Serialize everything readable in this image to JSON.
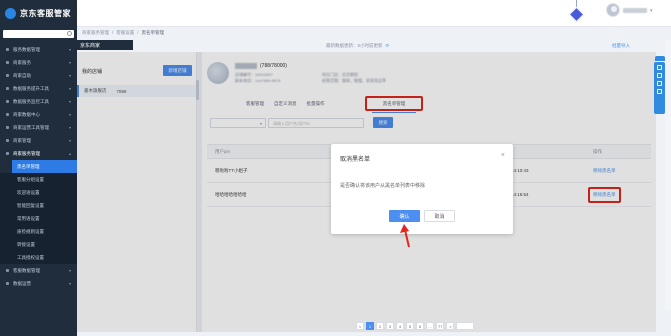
{
  "app": {
    "logo_text": "京东客服管家"
  },
  "breadcrumb": [
    "商家服务管理",
    "客服设置",
    "黑名单管理"
  ],
  "page_tab": "京东商家",
  "sync_text": "最新数据更新：5小时前更新",
  "right_link": "批量导入",
  "sidebar": {
    "search_placeholder": "",
    "items": [
      {
        "label": "服务数据管理",
        "open": false
      },
      {
        "label": "商家服务",
        "open": false
      },
      {
        "label": "商家自助",
        "open": false
      },
      {
        "label": "数据服务提升工具",
        "open": false
      },
      {
        "label": "数据服务监控工具",
        "open": false
      },
      {
        "label": "商家数据中心",
        "open": false
      },
      {
        "label": "商家运营工具管理",
        "open": false
      },
      {
        "label": "商家管理",
        "open": false
      },
      {
        "label": "商家服务管理",
        "open": true
      }
    ],
    "sub_items": [
      {
        "label": "黑名单管理",
        "active": true
      },
      {
        "label": "客服分组设置",
        "active": false
      },
      {
        "label": "欢迎语设置",
        "active": false
      },
      {
        "label": "智能回复设置",
        "active": false
      },
      {
        "label": "常用语设置",
        "active": false
      },
      {
        "label": "质检规则设置",
        "active": false
      },
      {
        "label": "转接设置",
        "active": false
      },
      {
        "label": "工具授权设置",
        "active": false
      }
    ],
    "bottom_items": [
      {
        "label": "客服数据管理"
      },
      {
        "label": "数据运营"
      }
    ]
  },
  "left_panel": {
    "title": "我的店铺",
    "create_button": "新增店铺",
    "shop_item_name": "嘉木旗舰店",
    "shop_item_id": "7898"
  },
  "shop": {
    "id_text": "(788/78000)",
    "info_left": [
      "店铺编号：10010007",
      "联系电话：1xx7989-4878"
    ],
    "info_right": [
      "所在门店：北京朝阳",
      "经营范围：服装、鞋帽、家居用品等"
    ]
  },
  "tabs": [
    "客服管理",
    "自定义消息",
    "批量操作"
  ],
  "active_tab": "黑名单管理",
  "filter": {
    "select_value": "",
    "input_placeholder": "请输入用户名/用户ID",
    "search_button": "搜索"
  },
  "table": {
    "headers": [
      "用户pin",
      "",
      "",
      "操作"
    ],
    "rows": [
      {
        "pin": "嗯啦啦TT小姐子",
        "time": "14:10:43",
        "op": "移除黑名单"
      },
      {
        "pin": "哈哈哈哈哈哈哈",
        "time": "14:16:54",
        "op": "移除黑名单"
      }
    ]
  },
  "modal": {
    "title": "取消黑名单",
    "close_glyph": "×",
    "body": "是否确认将该用户从黑名单列表中移除",
    "ok": "确认",
    "cancel": "取消"
  },
  "pagination": {
    "prev": "<",
    "pages": [
      "1",
      "2",
      "3",
      "4",
      "5",
      "6"
    ],
    "ellipsis": "…",
    "last": "77",
    "next": ">",
    "current": "1"
  },
  "colors": {
    "primary": "#4c8ff0",
    "sidebar_bg": "#1f2d3d",
    "highlight_red": "#e0271d"
  }
}
